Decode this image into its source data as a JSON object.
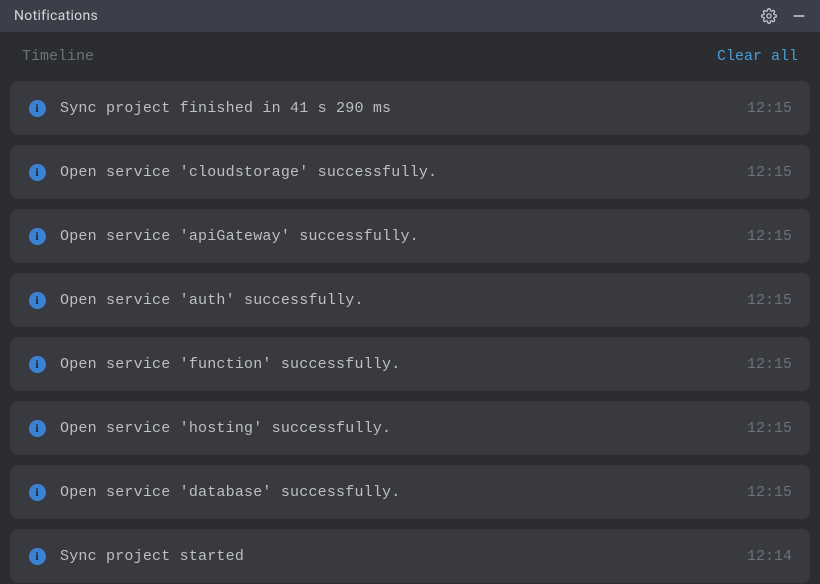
{
  "titlebar": {
    "title": "Notifications"
  },
  "header": {
    "label": "Timeline",
    "clear": "Clear all"
  },
  "items": [
    {
      "message": "Sync project finished in 41 s 290 ms",
      "time": "12:15"
    },
    {
      "message": "Open service 'cloudstorage' successfully.",
      "time": "12:15"
    },
    {
      "message": "Open service 'apiGateway' successfully.",
      "time": "12:15"
    },
    {
      "message": "Open service 'auth' successfully.",
      "time": "12:15"
    },
    {
      "message": "Open service 'function' successfully.",
      "time": "12:15"
    },
    {
      "message": "Open service 'hosting' successfully.",
      "time": "12:15"
    },
    {
      "message": "Open service 'database' successfully.",
      "time": "12:15"
    },
    {
      "message": "Sync project started",
      "time": "12:14"
    }
  ]
}
